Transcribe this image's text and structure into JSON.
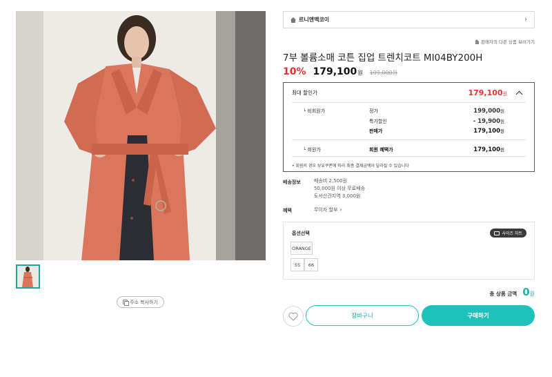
{
  "product": {
    "brand": "르니앤맥코이",
    "seller_link": "판매자의 다른 상품 보러가기",
    "title": "7부 볼륨소매 코튼 집업 트렌치코트 MI04BY200H",
    "discount_rate": "10%",
    "price": "179,100",
    "currency": "원",
    "original_price": "199,000원"
  },
  "discount_box": {
    "label": "최대 할인가",
    "max_price": "179,100",
    "currency": "원",
    "non_member_label": "비회원가",
    "regular_label": "정가",
    "regular_value": "199,000",
    "special_label": "특가할인",
    "special_value": "- 19,900",
    "sale_label": "판매가",
    "sale_value": "179,100",
    "member_label": "회원가",
    "member_benefit_label": "회원 혜택가",
    "member_benefit_value": "179,100",
    "notice": "• 회원의 경우 보유쿠폰에 따라 최종 결제금액이 달라질 수 있습니다"
  },
  "shipping": {
    "label": "배송정보",
    "lines": [
      "배송비 2,500원",
      "50,000원 이상 무료배송",
      "도서산간지역 3,000원"
    ]
  },
  "benefit": {
    "label": "혜택",
    "value": "무이자 할부"
  },
  "options": {
    "title": "옵션선택",
    "size_chart": "사이즈 차트",
    "colors": [
      "ORANGE"
    ],
    "sizes": [
      "55",
      "66"
    ]
  },
  "total": {
    "label": "총 상품 금액",
    "amount": "0",
    "currency": "원"
  },
  "buttons": {
    "copy_url": "주소 복사하기",
    "cart": "장바구니",
    "buy": "구매하기"
  },
  "icons": {
    "home": "home-icon",
    "chevron": "chevron-right-icon",
    "chevron_up": "chevron-up-icon",
    "heart": "heart-icon",
    "copy": "copy-icon",
    "ruler": "size-chart-icon"
  },
  "colors": {
    "accent": "#1fc2bb",
    "sale_red": "#e5322d"
  }
}
